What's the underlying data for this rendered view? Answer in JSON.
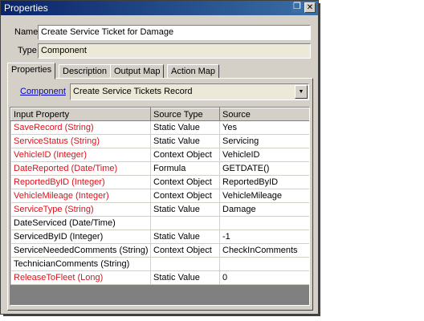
{
  "window": {
    "title": "Properties"
  },
  "form": {
    "name_label": "Name",
    "name_value": "Create Service Ticket for Damage",
    "type_label": "Type",
    "type_value": "Component"
  },
  "tabs": [
    {
      "label": "Properties",
      "active": true
    },
    {
      "label": "Description",
      "active": false
    },
    {
      "label": "Output Map",
      "active": false
    },
    {
      "label": "Action Map",
      "active": false
    }
  ],
  "component": {
    "link_label": "Component",
    "selected": "Create Service Tickets Record"
  },
  "grid": {
    "columns": [
      "Input Property",
      "Source Type",
      "Source"
    ],
    "rows": [
      {
        "property": "SaveRecord (String)",
        "source_type": "Static Value",
        "source": "Yes",
        "required": true
      },
      {
        "property": "ServiceStatus (String)",
        "source_type": "Static Value",
        "source": "Servicing",
        "required": true
      },
      {
        "property": "VehicleID (Integer)",
        "source_type": "Context Object",
        "source": "VehicleID",
        "required": true
      },
      {
        "property": "DateReported (Date/Time)",
        "source_type": "Formula",
        "source": "GETDATE()",
        "required": true
      },
      {
        "property": "ReportedByID (Integer)",
        "source_type": "Context Object",
        "source": "ReportedByID",
        "required": true
      },
      {
        "property": "VehicleMileage (Integer)",
        "source_type": "Context Object",
        "source": "VehicleMileage",
        "required": true
      },
      {
        "property": "ServiceType (String)",
        "source_type": "Static Value",
        "source": "Damage",
        "required": true
      },
      {
        "property": "DateServiced (Date/Time)",
        "source_type": "",
        "source": "",
        "required": false
      },
      {
        "property": "ServicedByID (Integer)",
        "source_type": "Static Value",
        "source": "-1",
        "required": false
      },
      {
        "property": "ServiceNeededComments (String)",
        "source_type": "Context Object",
        "source": "CheckInComments",
        "required": false
      },
      {
        "property": "TechnicianComments (String)",
        "source_type": "",
        "source": "",
        "required": false
      },
      {
        "property": "ReleaseToFleet (Long)",
        "source_type": "Static Value",
        "source": "0",
        "required": true
      }
    ]
  },
  "colors": {
    "required": "#e0101a",
    "title_bar": "#0a246a",
    "link": "#0000cc"
  }
}
